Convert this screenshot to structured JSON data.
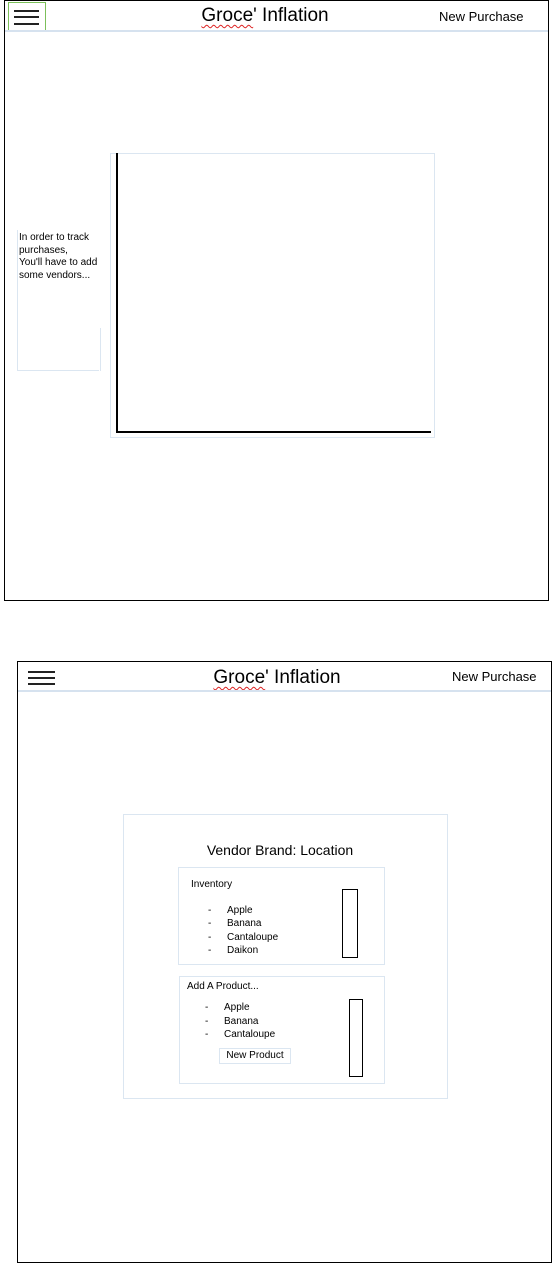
{
  "screen1": {
    "header": {
      "title_part1": "Groce",
      "title_part2": "' Inflation",
      "new_purchase": "New Purchase"
    },
    "empty_message": [
      "In order to track",
      "purchases,",
      "You'll have to add",
      "some vendors..."
    ]
  },
  "screen2": {
    "header": {
      "title_part1": "Groce",
      "title_part2": "' Inflation",
      "new_purchase": "New Purchase"
    },
    "vendor": {
      "title": "Vendor Brand: Location",
      "inventory": {
        "label": "Inventory",
        "items": [
          "Apple",
          "Banana",
          "Cantaloupe",
          "Daikon"
        ]
      },
      "add_product": {
        "label": "Add A Product...",
        "items": [
          "Apple",
          "Banana",
          "Cantaloupe"
        ],
        "new_product_button": "New Product"
      }
    }
  }
}
